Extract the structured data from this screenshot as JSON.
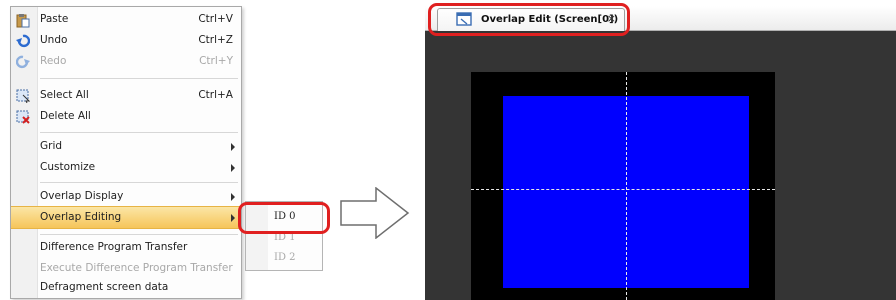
{
  "context_menu": {
    "items": [
      {
        "label": "Paste",
        "shortcut": "Ctrl+V",
        "icon": "paste-icon"
      },
      {
        "label": "Undo",
        "shortcut": "Ctrl+Z",
        "icon": "undo-icon"
      },
      {
        "label": "Redo",
        "shortcut": "Ctrl+Y",
        "icon": "redo-icon",
        "disabled": true
      },
      {
        "label": "Select All",
        "shortcut": "Ctrl+A",
        "icon": "select-all-icon"
      },
      {
        "label": "Delete All",
        "icon": "delete-all-icon"
      },
      {
        "label": "Grid",
        "submenu": true
      },
      {
        "label": "Customize",
        "submenu": true
      },
      {
        "label": "Overlap Display",
        "submenu": true
      },
      {
        "label": "Overlap Editing",
        "submenu": true,
        "highlighted": true
      },
      {
        "label": "Difference Program Transfer"
      },
      {
        "label": "Execute Difference Program Transfer",
        "disabled": true
      },
      {
        "label": "Defragment screen data"
      }
    ]
  },
  "submenu": {
    "items": [
      {
        "label": "ID 0"
      },
      {
        "label": "ID 1",
        "disabled": true
      },
      {
        "label": "ID 2",
        "disabled": true
      }
    ]
  },
  "editor": {
    "tab_label": "Overlap Edit (Screen[0])",
    "tab_close": "×"
  },
  "colors": {
    "highlight": "#f6c55a",
    "callout": "#e02020",
    "canvas_bg": "#343434",
    "screen_border": "#000000",
    "screen_fill": "#0000ff"
  }
}
